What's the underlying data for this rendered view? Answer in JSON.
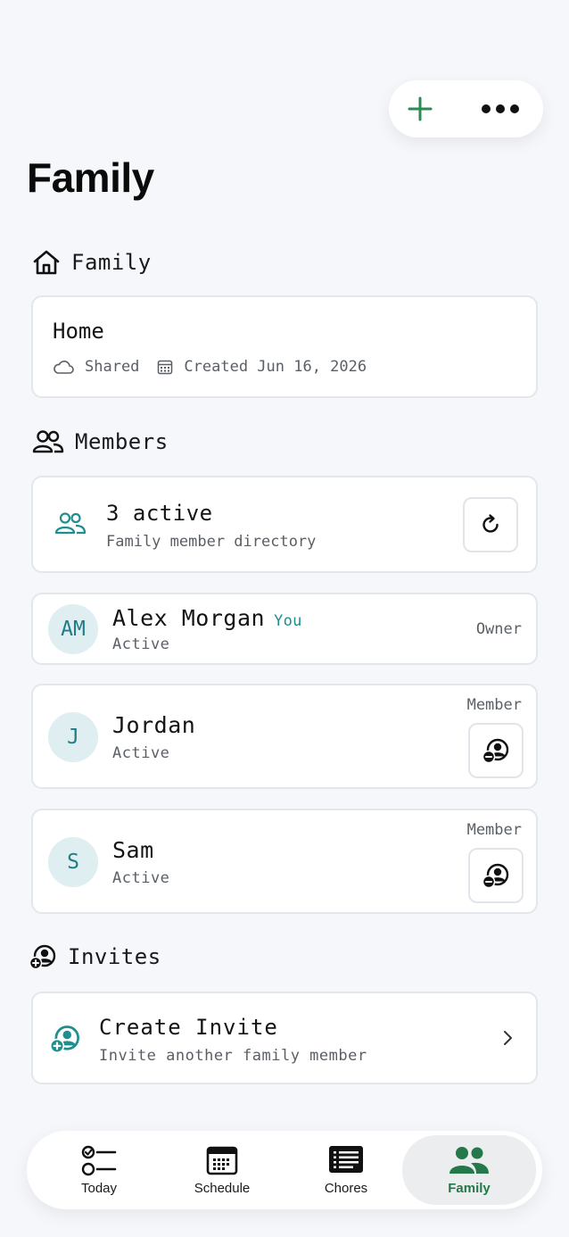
{
  "page": {
    "title": "Family"
  },
  "sections": {
    "family": "Family",
    "members": "Members",
    "invites": "Invites"
  },
  "household": {
    "name": "Home",
    "sharing": "Shared",
    "created": "Created Jun 16, 2026"
  },
  "members_summary": {
    "count_label": "3 active",
    "subtitle": "Family member directory"
  },
  "members": [
    {
      "initials": "AM",
      "name": "Alex Morgan",
      "you_badge": "You",
      "status": "Active",
      "role": "Owner"
    },
    {
      "initials": "J",
      "name": "Jordan",
      "status": "Active",
      "role": "Member"
    },
    {
      "initials": "S",
      "name": "Sam",
      "status": "Active",
      "role": "Member"
    }
  ],
  "invite": {
    "title": "Create Invite",
    "subtitle": "Invite another family member"
  },
  "tabs": [
    {
      "label": "Today",
      "icon": "checklist-icon"
    },
    {
      "label": "Schedule",
      "icon": "calendar-icon"
    },
    {
      "label": "Chores",
      "icon": "list-icon"
    },
    {
      "label": "Family",
      "icon": "people-icon",
      "active": true
    }
  ],
  "colors": {
    "accent_green": "#24784a",
    "teal": "#1f8e8e",
    "background": "#f5f7fa"
  }
}
